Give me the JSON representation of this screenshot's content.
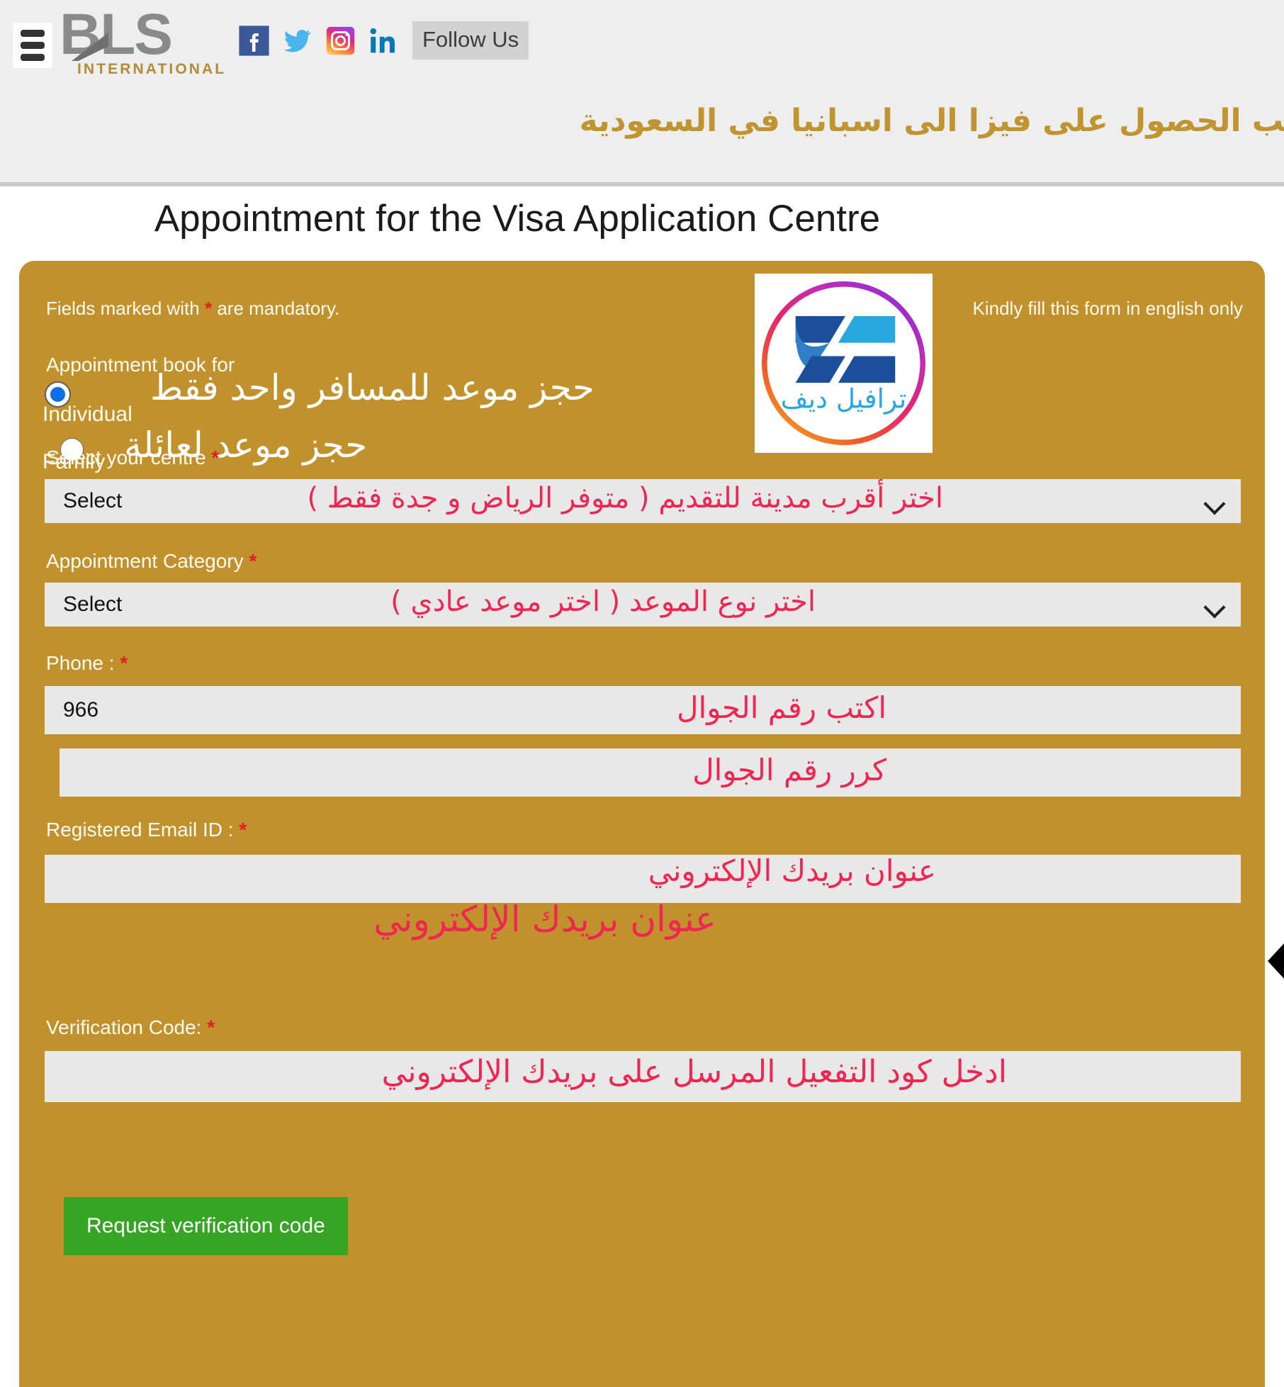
{
  "header": {
    "menu_icon": "hamburger-icon",
    "brand": {
      "name": "BLS",
      "subtitle": "INTERNATIONAL"
    },
    "social": [
      {
        "name": "facebook-icon",
        "label": "Facebook"
      },
      {
        "name": "twitter-icon",
        "label": "Twitter"
      },
      {
        "name": "instagram-icon",
        "label": "Instagram"
      },
      {
        "name": "linkedin-icon",
        "label": "LinkedIn"
      }
    ],
    "follow_us": "Follow Us",
    "arabic_banner": "لب الحصول على فيزا الى اسبانيا في السعودية"
  },
  "page_title": "Appointment for the Visa Application Centre",
  "form": {
    "mandatory_note_prefix": "Fields marked with",
    "mandatory_star": "*",
    "mandatory_note_suffix": "are mandatory.",
    "english_only_note": "Kindly fill this form in english only",
    "appointment_book_for_label": "Appointment book for",
    "radios": [
      {
        "label": "Individual",
        "selected": true,
        "arabic_note": "حجز موعد للمسافر واحد فقط"
      },
      {
        "label": "Family",
        "selected": false,
        "arabic_note": "حجز موعد لعائلة"
      }
    ],
    "logo": {
      "name": "travel-deef-logo",
      "arabic_text": "ترافيل ديف"
    },
    "fields": {
      "centre": {
        "label": "Select your centre",
        "required": "*",
        "value": "Select",
        "arabic_hint": "اختر أقرب مدينة للتقديم ( متوفر الرياض و جدة فقط )"
      },
      "category": {
        "label": "Appointment Category",
        "required": "*",
        "value": "Select",
        "arabic_hint": "اختر نوع الموعد ( اختر موعد عادي )"
      },
      "phone": {
        "label": "Phone :",
        "required": "*",
        "value": "966",
        "arabic_hint": "اكتب رقم الجوال"
      },
      "phone_confirm": {
        "value": "",
        "arabic_hint": "كرر رقم الجوال"
      },
      "email": {
        "label": "Registered Email ID :",
        "required": "*",
        "value": "",
        "arabic_hint": "عنوان بريدك الإلكتروني",
        "arabic_hint_overlay": "عنوان بريدك الإلكتروني"
      },
      "verification_code": {
        "label": "Verification Code:",
        "required": "*",
        "value": "",
        "arabic_hint": "ادخل كود التفعيل المرسل على بريدك الإلكتروني"
      }
    },
    "request_code_button": "Request verification code"
  },
  "colors": {
    "card_background": "#c1912d",
    "accent_green": "#37a524",
    "arabic_pink": "#ef2651",
    "arabic_gold": "#bf9431",
    "required_red": "#e02020",
    "field_background": "#e8e8e8"
  }
}
